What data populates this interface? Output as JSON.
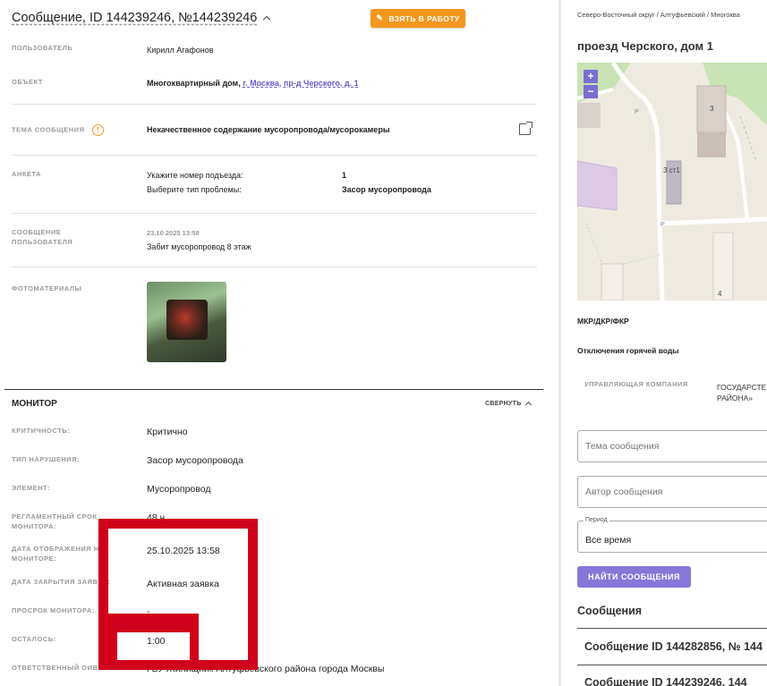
{
  "header": {
    "title": "Сообщение, ID 144239246, №144239246",
    "take_button": "ВЗЯТЬ В РАБОТУ"
  },
  "details": {
    "user_label": "ПОЛЬЗОВАТЕЛЬ",
    "user_value": "Кирилл Агафонов",
    "object_label": "ОБЪЕКТ",
    "object_prefix": "Многоквартирный дом,",
    "object_link": "г. Москва, пр-д Черского, д. 1",
    "topic_label": "ТЕМА СООБЩЕНИЯ",
    "topic_value": "Некачественное содержание мусоропровода/мусорокамеры",
    "form_label": "АНКЕТА",
    "form_q1": "Укажите номер подъезда:",
    "form_a1": "1",
    "form_q2": "Выберите тип проблемы:",
    "form_a2": "Засор мусоропровода",
    "msg_label_1": "СООБЩЕНИЕ",
    "msg_label_2": "ПОЛЬЗОВАТЕЛЯ",
    "msg_date": "23.10.2025 13:58",
    "msg_text": "Забит мусоропровод 8 этаж",
    "photo_label": "ФОТОМАТЕРИАЛЫ"
  },
  "monitor": {
    "title": "МОНИТОР",
    "collapse": "СВЕРНУТЬ",
    "rows": [
      {
        "label": "КРИТИЧНОСТЬ:",
        "value": "Критично"
      },
      {
        "label": "ТИП НАРУШЕНИЯ:",
        "value": "Засор мусоропровода"
      },
      {
        "label": "ЭЛЕМЕНТ:",
        "value": "Мусоропровод"
      },
      {
        "label": "РЕГЛАМЕНТНЫЙ СРОК МОНИТОРА:",
        "value": "48 ч"
      },
      {
        "label": "ДАТА ОТОБРАЖЕНИЯ НА МОНИТОРЕ:",
        "value": "25.10.2025 13:58"
      },
      {
        "label": "ДАТА ЗАКРЫТИЯ ЗАЯВКИ:",
        "value": "Активная заявка"
      },
      {
        "label": "ПРОСРОК МОНИТОРА:",
        "value": "-"
      },
      {
        "label": "ОСТАЛОСЬ:",
        "value": "1:00"
      },
      {
        "label": "ОТВЕТСТВЕННЫЙ ОИВ:",
        "value": "ГБУ Жилищник Алтуфьевского района города Москвы"
      }
    ]
  },
  "sidebar": {
    "breadcrumb": "Северо-Восточный округ / Алтуфьевский / Многоква",
    "address": "проезд Черского, дом 1",
    "zoom_in": "+",
    "zoom_out": "−",
    "map_labels": [
      "3",
      "3 ст1",
      "4",
      "P",
      "P"
    ],
    "mkr": "МКР/ДКР/ФКР",
    "hot_water": "Отключения горячей воды",
    "mgmt_label": "УПРАВЛЯЮЩАЯ КОМПАНИЯ",
    "mgmt_value_1": "ГОСУДАРСТЕ",
    "mgmt_value_2": "РАЙОНА»",
    "topic_placeholder": "Тема сообщения",
    "author_placeholder": "Автор сообщения",
    "period_legend": "Период",
    "period_value": "Все время",
    "find_button": "НАЙТИ СООБЩЕНИЯ",
    "messages_title": "Сообщения",
    "messages": [
      "Сообщение ID 144282856, № 144",
      "Сообщение ID 144239246, 144"
    ]
  },
  "colors": {
    "accent_orange": "#f5961e",
    "accent_purple": "#8777d9",
    "annotation_red": "#d0021b"
  }
}
